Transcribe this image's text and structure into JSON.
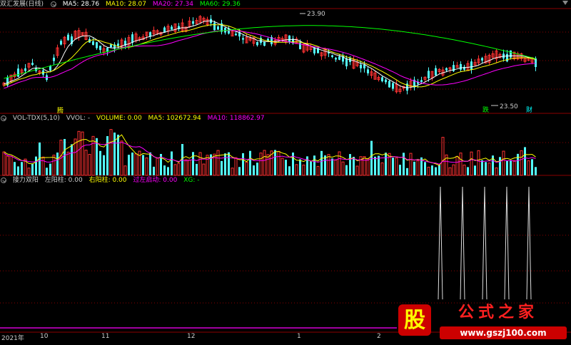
{
  "main_header": {
    "title": "双汇发展(日线)",
    "ma5_label": "MA5: 28.76",
    "ma10_label": "MA10: 28.07",
    "ma20_label": "MA20: 27.34",
    "ma60_label": "MA60: 29.36"
  },
  "vol_header": {
    "name": "VOL-TDX(5,10)",
    "vvol": "VVOL: -",
    "volume": "VOLUME: 0.00",
    "ma5": "MA5: 102672.94",
    "ma10": "MA10: 118862.97"
  },
  "ind_header": {
    "name": "接力双阳",
    "left": "左阳柱: 0.00",
    "right": "右阳柱: 0.00",
    "start": "过左启动: 0.00",
    "xg": "XG: -"
  },
  "annotations": {
    "high": "23.90",
    "low": "23.50",
    "tag_teng": "腾",
    "tag_die": "跌",
    "tag_cai": "财"
  },
  "time_axis": [
    "2021年",
    "10",
    "11",
    "12",
    "1",
    "2"
  ],
  "logo": {
    "title": "公式之家",
    "url": "www.gszj100.com",
    "badge": "股"
  },
  "colors": {
    "up": "#ff3232",
    "down": "#54ffff",
    "ma5": "#ffffff",
    "ma10": "#ffff00",
    "ma20": "#ff00ff",
    "ma60": "#00ff00",
    "grid": "#8b0000"
  },
  "chart_data": [
    {
      "type": "candlestick",
      "title": "双汇发展(日线)",
      "price_markers": {
        "high": 23.9,
        "low": 23.5
      },
      "series": [
        {
          "name": "MA5",
          "values": [
            28.76
          ]
        },
        {
          "name": "MA10",
          "values": [
            28.07
          ]
        },
        {
          "name": "MA20",
          "values": [
            27.34
          ]
        },
        {
          "name": "MA60",
          "values": [
            29.36
          ]
        }
      ],
      "x_ticks": [
        "2021年",
        "10",
        "11",
        "12",
        "1",
        "2"
      ]
    },
    {
      "type": "bar",
      "title": "VOL-TDX(5,10)",
      "series": [
        {
          "name": "VOLUME",
          "values": [
            0.0
          ]
        },
        {
          "name": "MA5",
          "values": [
            102672.94
          ]
        },
        {
          "name": "MA10",
          "values": [
            118862.97
          ]
        }
      ]
    },
    {
      "type": "line",
      "title": "接力双阳",
      "series": [
        {
          "name": "左阳柱",
          "values": [
            0.0
          ]
        },
        {
          "name": "右阳柱",
          "values": [
            0.0
          ]
        },
        {
          "name": "过左启动",
          "values": [
            0.0
          ]
        },
        {
          "name": "XG",
          "values": []
        }
      ],
      "signal_count": 5
    }
  ]
}
